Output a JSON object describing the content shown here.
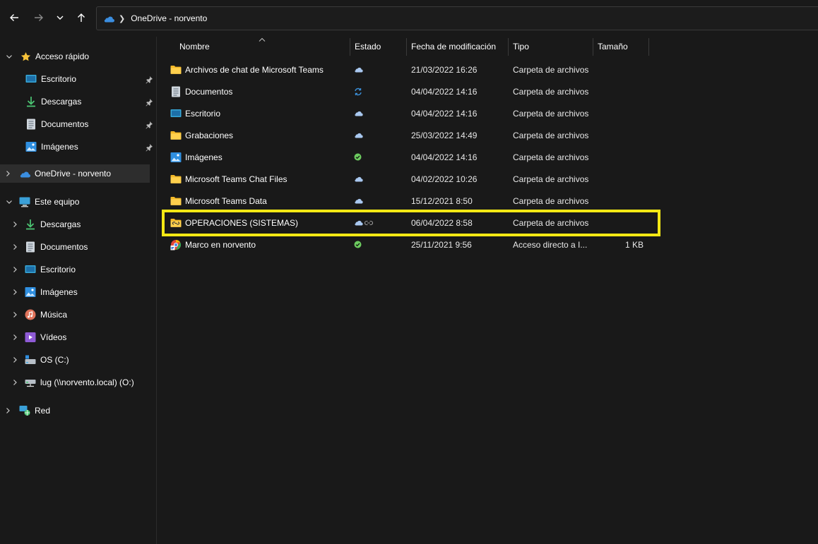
{
  "address": {
    "path": [
      "OneDrive - norvento"
    ]
  },
  "sidebar": {
    "quick_access": {
      "label": "Acceso rápido",
      "items": [
        {
          "label": "Escritorio",
          "icon": "desktop-icon"
        },
        {
          "label": "Descargas",
          "icon": "download-icon"
        },
        {
          "label": "Documentos",
          "icon": "document-icon"
        },
        {
          "label": "Imágenes",
          "icon": "pictures-icon"
        }
      ]
    },
    "onedrive": {
      "label": "OneDrive - norvento"
    },
    "this_pc": {
      "label": "Este equipo",
      "items": [
        {
          "label": "Descargas",
          "icon": "download-icon"
        },
        {
          "label": "Documentos",
          "icon": "document-icon"
        },
        {
          "label": "Escritorio",
          "icon": "desktop-icon"
        },
        {
          "label": "Imágenes",
          "icon": "pictures-icon"
        },
        {
          "label": "Música",
          "icon": "music-icon"
        },
        {
          "label": "Vídeos",
          "icon": "videos-icon"
        },
        {
          "label": "OS (C:)",
          "icon": "drive-c-icon"
        },
        {
          "label": "lug (\\\\norvento.local) (O:)",
          "icon": "network-drive-icon"
        }
      ]
    },
    "network": {
      "label": "Red"
    }
  },
  "columns": {
    "name": "Nombre",
    "state": "Estado",
    "modified": "Fecha de modificación",
    "type": "Tipo",
    "size": "Tamaño"
  },
  "files": [
    {
      "name": "Archivos de chat de Microsoft Teams",
      "icon": "folder-icon",
      "state": "cloud",
      "modified": "21/03/2022 16:26",
      "type": "Carpeta de archivos",
      "size": ""
    },
    {
      "name": "Documentos",
      "icon": "document-icon",
      "state": "sync",
      "modified": "04/04/2022 14:16",
      "type": "Carpeta de archivos",
      "size": ""
    },
    {
      "name": "Escritorio",
      "icon": "desktop-icon",
      "state": "cloud",
      "modified": "04/04/2022 14:16",
      "type": "Carpeta de archivos",
      "size": ""
    },
    {
      "name": "Grabaciones",
      "icon": "folder-icon",
      "state": "cloud",
      "modified": "25/03/2022 14:49",
      "type": "Carpeta de archivos",
      "size": ""
    },
    {
      "name": "Imágenes",
      "icon": "pictures-icon",
      "state": "available",
      "modified": "04/04/2022 14:16",
      "type": "Carpeta de archivos",
      "size": ""
    },
    {
      "name": "Microsoft Teams Chat Files",
      "icon": "folder-icon",
      "state": "cloud",
      "modified": "04/02/2022 10:26",
      "type": "Carpeta de archivos",
      "size": ""
    },
    {
      "name": "Microsoft Teams Data",
      "icon": "folder-icon",
      "state": "cloud",
      "modified": "15/12/2021 8:50",
      "type": "Carpeta de archivos",
      "size": ""
    },
    {
      "name": "OPERACIONES (SISTEMAS)",
      "icon": "shared-folder-icon",
      "state": "cloud-shared",
      "modified": "06/04/2022 8:58",
      "type": "Carpeta de archivos",
      "size": ""
    },
    {
      "name": "Marco en norvento",
      "icon": "shortcut-icon",
      "state": "available",
      "modified": "25/11/2021 9:56",
      "type": "Acceso directo a I...",
      "size": "1 KB"
    }
  ],
  "colors": {
    "background": "#191919",
    "highlight": "#f3e814",
    "cloud": "#a9c8f0",
    "available": "#6ccb5f",
    "sync": "#3a8fd8"
  }
}
